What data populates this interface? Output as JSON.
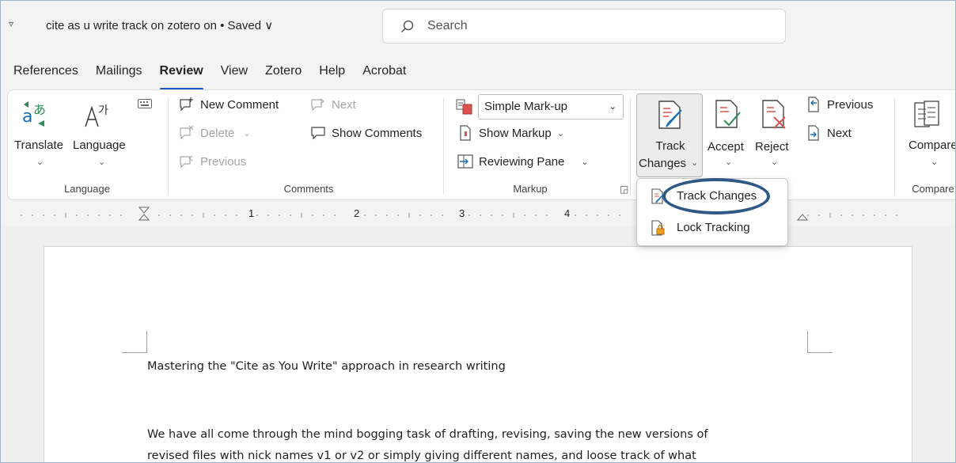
{
  "titlebar": {
    "doc_title": "cite as u write track on zotero on • Saved ∨",
    "search_placeholder": "Search"
  },
  "tabs": [
    {
      "label": "References"
    },
    {
      "label": "Mailings"
    },
    {
      "label": "Review",
      "active": true
    },
    {
      "label": "View"
    },
    {
      "label": "Zotero"
    },
    {
      "label": "Help"
    },
    {
      "label": "Acrobat"
    }
  ],
  "ribbon": {
    "language": {
      "translate_label": "Translate",
      "language_label": "Language",
      "group_label": "Language"
    },
    "comments": {
      "new_comment": "New Comment",
      "next": "Next",
      "delete": "Delete",
      "show_comments": "Show Comments",
      "previous": "Previous",
      "group_label": "Comments"
    },
    "markup": {
      "display_value": "Simple Mark-up",
      "show_markup": "Show Markup",
      "reviewing_pane": "Reviewing Pane",
      "group_label": "Markup"
    },
    "tracking": {
      "track_line1": "Track",
      "track_line2": "Changes",
      "accept": "Accept",
      "reject": "Reject",
      "previous": "Previous",
      "next": "Next"
    },
    "compare": {
      "compare_label": "Compare",
      "group_label": "Compare"
    }
  },
  "ruler": {
    "numbers": [
      "1",
      "2",
      "3",
      "4"
    ]
  },
  "menu": {
    "items": [
      {
        "label": "Track Changes"
      },
      {
        "label": "Lock Tracking"
      }
    ]
  },
  "document": {
    "heading": "Mastering the \"Cite as You Write\" approach in research writing",
    "para_line1": "We have all come through the mind bogging task of drafting, revising, saving the new versions of",
    "para_line2": "revised files with nick names v1 or v2 or simply giving different names, and loose track of what"
  },
  "colors": {
    "accent": "#185abd",
    "annotation": "#2f5a86"
  }
}
